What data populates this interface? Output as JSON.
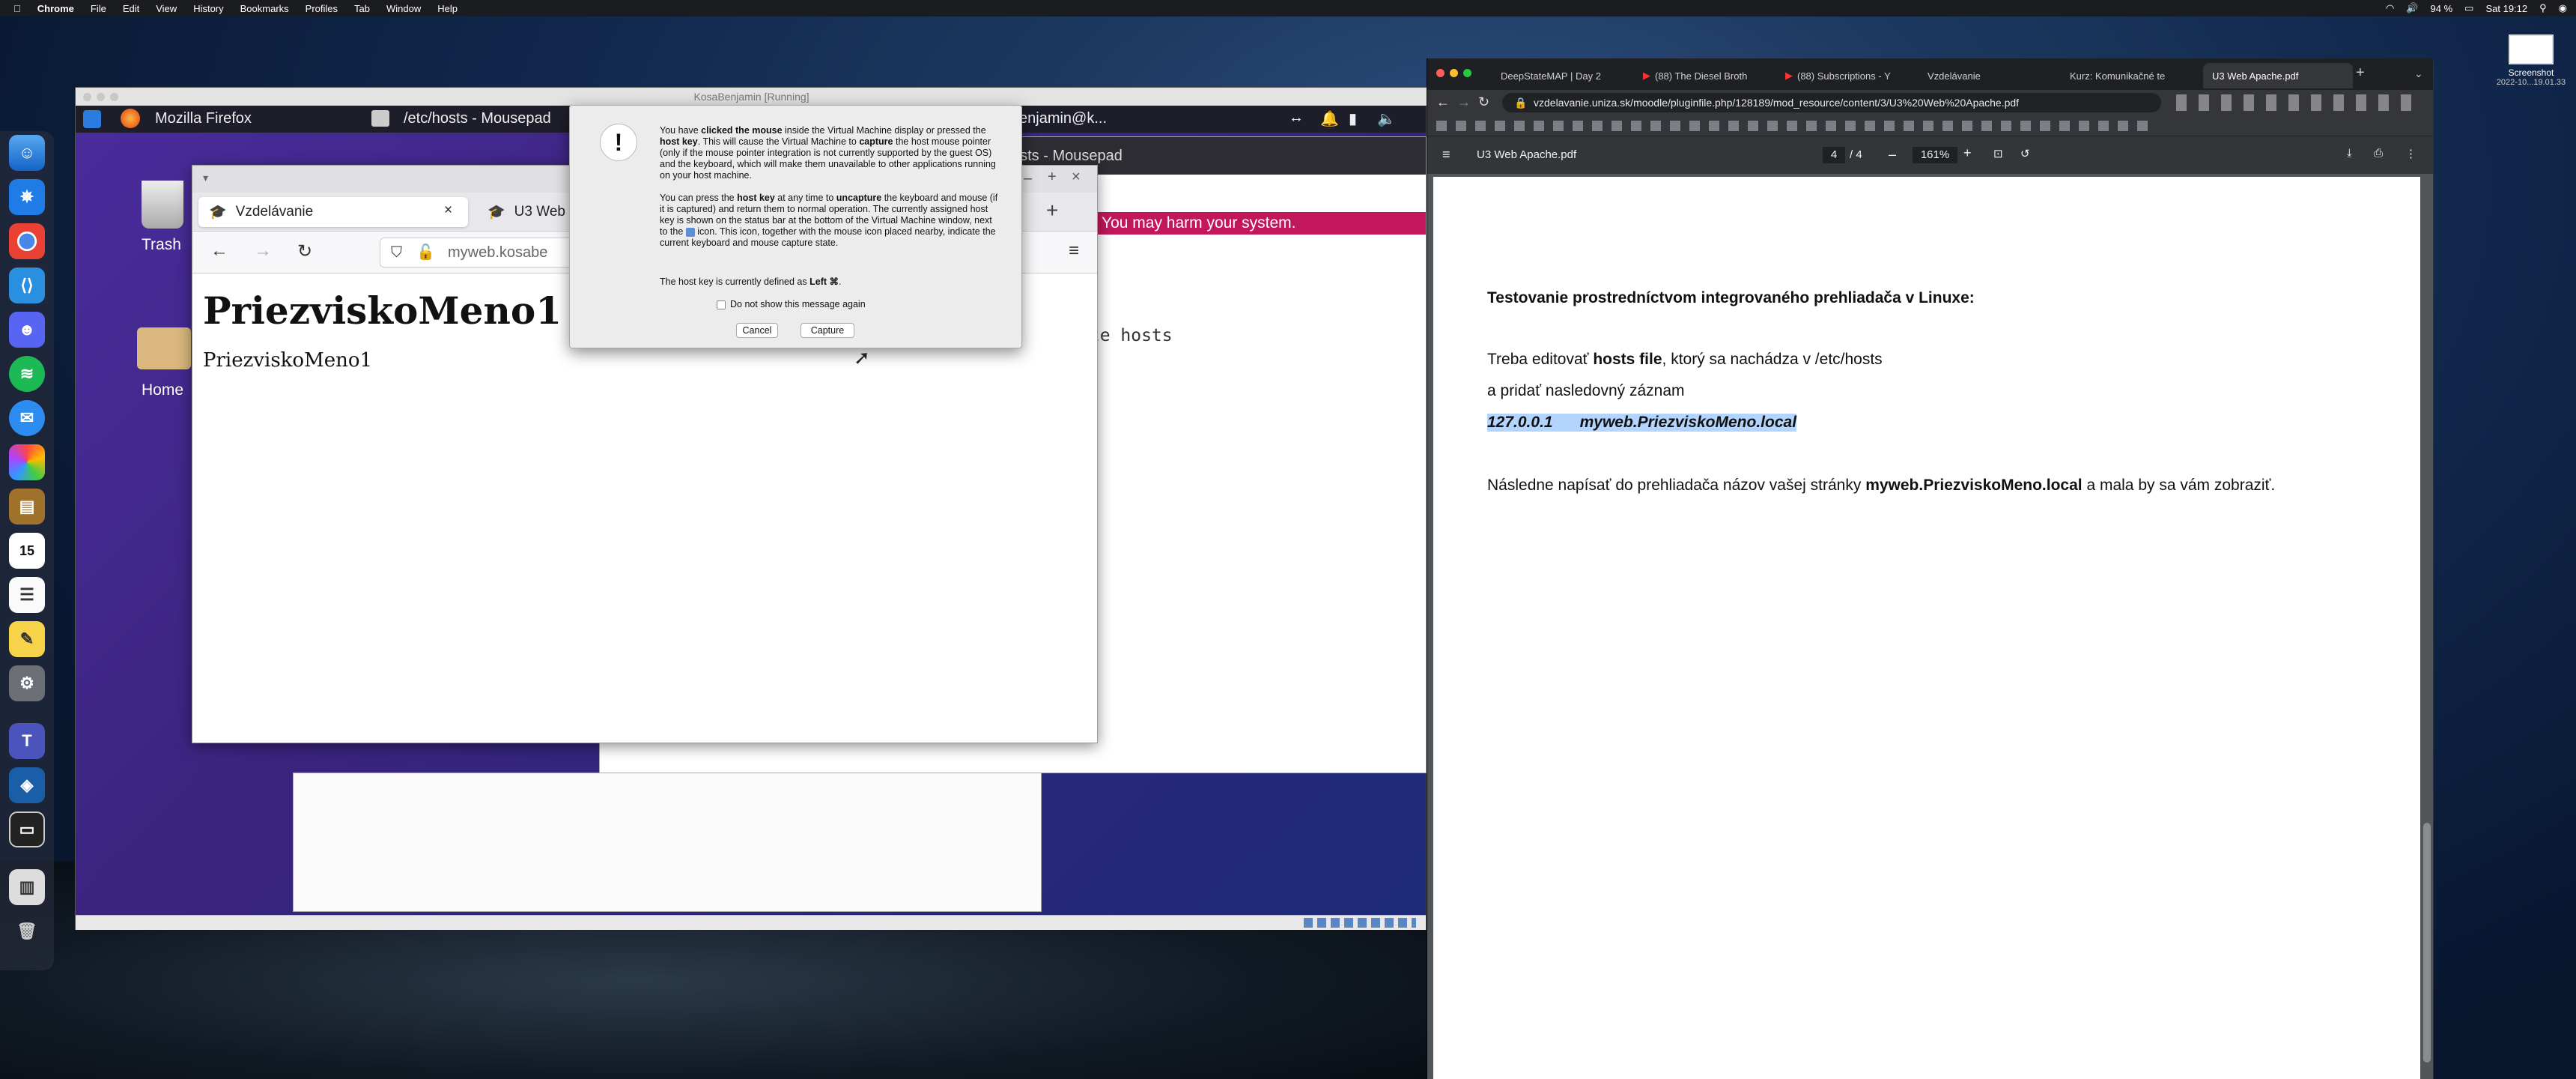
{
  "menubar": {
    "app": "Chrome",
    "items": [
      "File",
      "Edit",
      "View",
      "History",
      "Bookmarks",
      "Profiles",
      "Tab",
      "Window",
      "Help"
    ],
    "battery": "94 %",
    "clock": "Sat 19:12"
  },
  "desktop": {
    "screenshot_label": "Screenshot",
    "screenshot_date": "2022-10...19.01.33"
  },
  "vbox": {
    "title": "KosaBenjamin [Running]"
  },
  "guest_panel": {
    "firefox_task": "Mozilla Firefox",
    "mousepad_task": "/etc/hosts - Mousepad",
    "terminal_task": "enjamin@k..."
  },
  "guest_desktop": {
    "trash": "Trash",
    "home": "Home"
  },
  "firefox": {
    "tab1": "Vzdelávanie",
    "tab2": "U3 Web",
    "url": "myweb.kosabe",
    "heading": "PriezviskoMeno1",
    "text": "PriezviskoMeno1"
  },
  "mousepad": {
    "title": "osts - Mousepad",
    "warning": "You may harm your system.",
    "content": "ple hosts"
  },
  "alert": {
    "p1a": "You have ",
    "p1b": "clicked the mouse",
    "p1c": " inside the Virtual Machine display or pressed the ",
    "p1d": "host key",
    "p1e": ". This will cause the Virtual Machine to ",
    "p1f": "capture",
    "p1g": " the host mouse pointer (only if the mouse pointer integration is not currently supported by the guest OS) and the keyboard, which will make them unavailable to other applications running on your host machine.",
    "p2a": "You can press the ",
    "p2b": "host key",
    "p2c": " at any time to ",
    "p2d": "uncapture",
    "p2e": " the keyboard and mouse (if it is captured) and return them to normal operation. The currently assigned host key is shown on the status bar at the bottom of the Virtual Machine window, next to the ",
    "p2f": " icon. This icon, together with the mouse icon placed nearby, indicate the current keyboard and mouse capture state.",
    "p3a": "The host key is currently defined as ",
    "p3b": "Left ⌘",
    "checkbox": "Do not show this message again",
    "cancel": "Cancel",
    "capture": "Capture"
  },
  "chrome": {
    "tabs": [
      "DeepStateMAP | Day 2",
      "(88) The Diesel Broth",
      "(88) Subscriptions - Y",
      "Vzdelávanie",
      "Kurz: Komunikačné te",
      "U3 Web Apache.pdf"
    ],
    "url": "vzdelavanie.uniza.sk/moodle/pluginfile.php/128189/mod_resource/content/3/U3%20Web%20Apache.pdf"
  },
  "pdf": {
    "title": "U3 Web Apache.pdf",
    "page": "4",
    "pages": "/ 4",
    "zoom": "161%",
    "heading": "Testovanie prostredníctvom integrovaného prehliadača v Linuxe:",
    "l1a": "Treba editovať ",
    "l1b": "hosts file",
    ", ktorý sa nachádza v /etc/hosts": ", ktorý sa nachádza v /etc/hosts",
    "l1c": ", ktorý sa nachádza v /etc/hosts",
    "l2": "a pridať nasledovný záznam",
    "ip": "127.0.0.1",
    "host": "myweb.PriezviskoMeno.local",
    "l3a": "Následne napísať do prehliadača názov vašej stránky ",
    "l3b": "myweb.PriezviskoMeno.local",
    "l3c": " a mala by sa vám zobraziť."
  }
}
